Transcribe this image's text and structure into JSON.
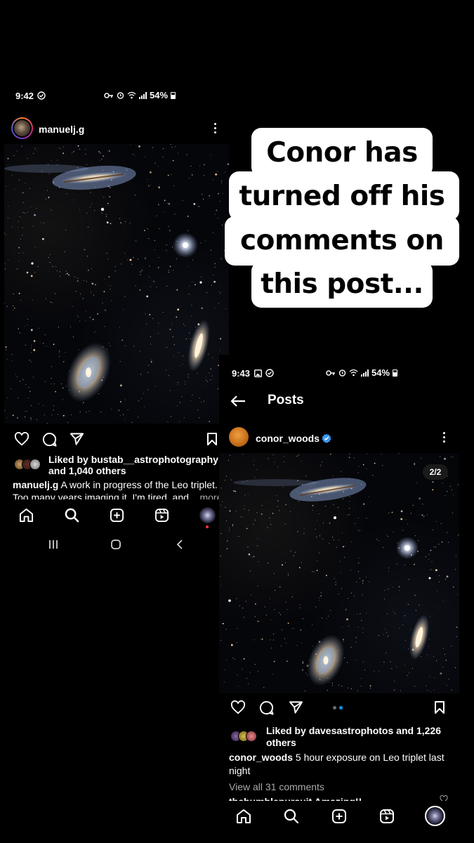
{
  "caption": {
    "lines": [
      "Conor has",
      "turned off his",
      "comments on",
      "this post..."
    ]
  },
  "left": {
    "status": {
      "time": "9:42",
      "battery": "54%"
    },
    "post": {
      "username": "manuelj.g",
      "liked_by_prefix": "Liked by ",
      "liked_by_user": "bustab__astrophotography",
      "liked_by_others": "and 1,040 others",
      "caption_user": "manuelj.g",
      "caption_text": " A work in progress of the Leo triplet.",
      "caption_line2": "Too many years imaging it. I'm tired, and",
      "more_label": "... more"
    },
    "nav": [
      "home-icon",
      "search-icon",
      "create-icon",
      "reels-icon",
      "profile-icon"
    ],
    "system_nav": [
      "recents-icon",
      "home-system-icon",
      "back-icon"
    ]
  },
  "right": {
    "status": {
      "time": "9:43",
      "battery": "54%"
    },
    "header": {
      "title": "Posts"
    },
    "post": {
      "username": "conor_woods",
      "verified": true,
      "counter": "2/2",
      "liked_by_prefix": "Liked by ",
      "liked_by_user": "davesastrophotos",
      "liked_by_rest": " and 1,226",
      "liked_by_line2": "others",
      "caption_user": "conor_woods",
      "caption_text": " 5 hour exposure on Leo triplet last",
      "caption_line2": "night",
      "view_comments": "View all 31 comments",
      "comment_preview": "thehumblepursuit Amazing!!"
    },
    "nav": [
      "home-icon",
      "search-icon",
      "create-icon",
      "reels-icon",
      "profile-icon"
    ]
  },
  "colors": {
    "background": "#000000",
    "text": "#ffffff",
    "muted": "#a8a8a8",
    "verified": "#3897f0",
    "notification": "#ff3040",
    "carousel_dot_active": "#0095f6",
    "carousel_dot_inactive": "#6b6b6b"
  }
}
